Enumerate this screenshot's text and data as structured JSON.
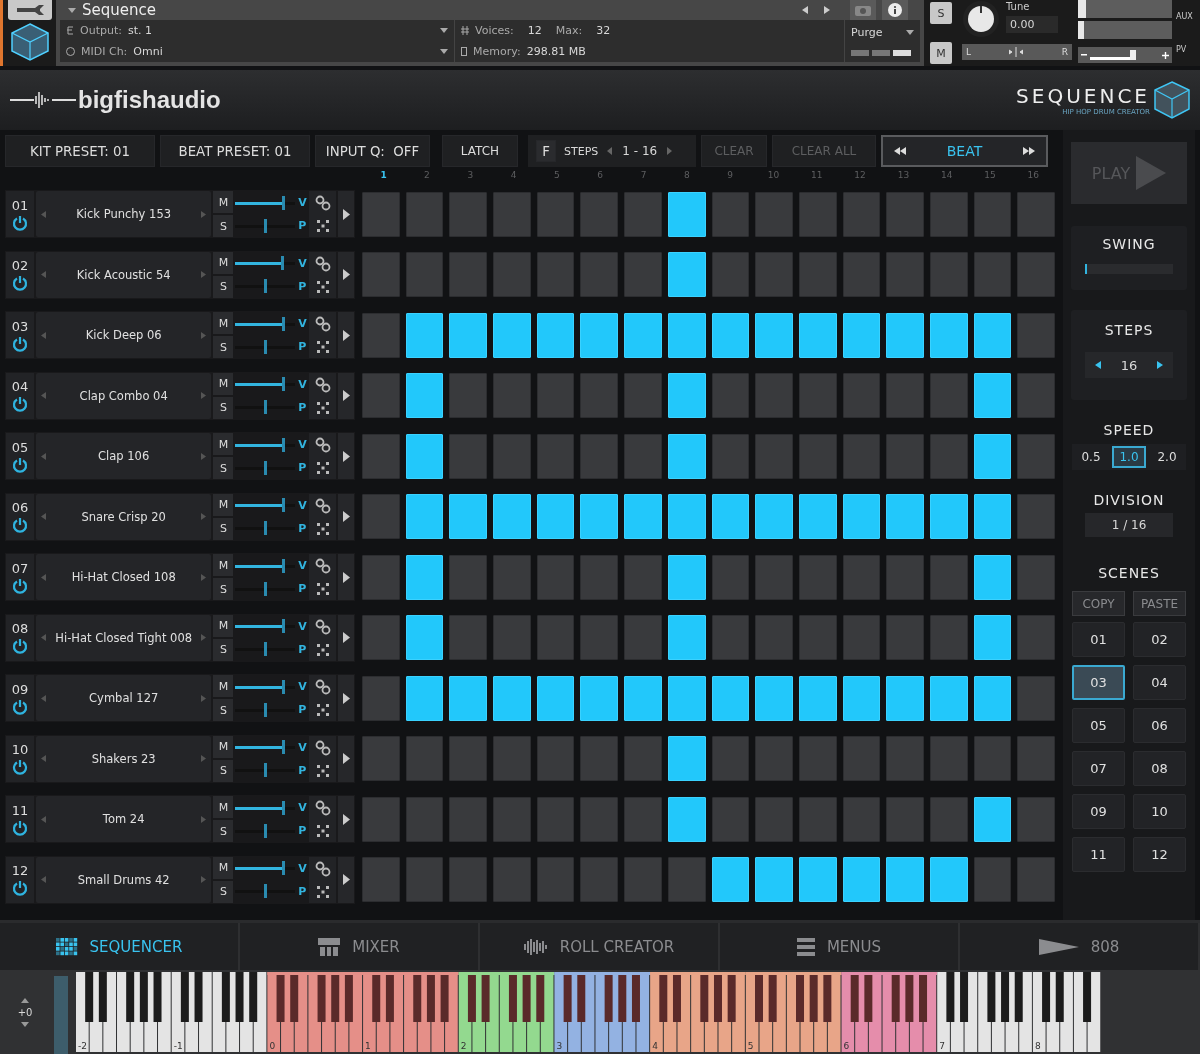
{
  "host": {
    "title": "Sequence",
    "output_label": "Output:",
    "output": "st. 1",
    "midi_label": "MIDI Ch:",
    "midi": "Omni",
    "voices_label": "Voices:",
    "voices": "12",
    "max_label": "Max:",
    "max": "32",
    "memory_label": "Memory:",
    "memory": "298.81 MB",
    "purge": "Purge",
    "solo": "S",
    "mute": "M",
    "tune_label": "Tune",
    "tune": "0.00",
    "pan_left": "L",
    "pan_right": "R",
    "aux": "AUX",
    "pv": "PV",
    "meters": [
      {
        "level": 0.08
      },
      {
        "level": 0.06
      }
    ],
    "pan": {
      "level": 0.5
    },
    "volume": {
      "level": 0.62
    }
  },
  "brand": {
    "name": "bigfishaudio",
    "product": "SEQUENCE",
    "tagline": "HIP HOP DRUM CREATOR"
  },
  "toolbar": {
    "kit_preset": "KIT PRESET: 01",
    "beat_preset": "BEAT PRESET: 01",
    "input_q": "INPUT Q:  OFF",
    "latch": "LATCH",
    "f": "F",
    "steps_label": "STEPS",
    "steps_range": "1 - 16",
    "clear": {
      "label": "CLEAR",
      "disabled": true
    },
    "clear_all": {
      "label": "CLEAR ALL",
      "disabled": true
    },
    "mode": "BEAT"
  },
  "step_numbers": [
    {
      "label": "1",
      "highlighted": true
    },
    {
      "label": "2",
      "highlighted": false
    },
    {
      "label": "3",
      "highlighted": false
    },
    {
      "label": "4",
      "highlighted": false
    },
    {
      "label": "5",
      "highlighted": false
    },
    {
      "label": "6",
      "highlighted": false
    },
    {
      "label": "7",
      "highlighted": false
    },
    {
      "label": "8",
      "highlighted": false
    },
    {
      "label": "9",
      "highlighted": false
    },
    {
      "label": "10",
      "highlighted": false
    },
    {
      "label": "11",
      "highlighted": false
    },
    {
      "label": "12",
      "highlighted": false
    },
    {
      "label": "13",
      "highlighted": false
    },
    {
      "label": "14",
      "highlighted": false
    },
    {
      "label": "15",
      "highlighted": false
    },
    {
      "label": "16",
      "highlighted": false
    }
  ],
  "tracks": [
    {
      "number": "01",
      "power_on": true,
      "name": "Kick Punchy 153",
      "mute_label": "M",
      "solo_label": "S",
      "volume_label": "V",
      "pan_label": "P",
      "volume": {
        "level": 0.8
      },
      "pan": {
        "level": 0.5
      },
      "steps": [
        false,
        false,
        false,
        false,
        false,
        false,
        false,
        true,
        false,
        false,
        false,
        false,
        false,
        false,
        false,
        false
      ]
    },
    {
      "number": "02",
      "power_on": true,
      "name": "Kick Acoustic 54",
      "mute_label": "M",
      "solo_label": "S",
      "volume_label": "V",
      "pan_label": "P",
      "volume": {
        "level": 0.78
      },
      "pan": {
        "level": 0.5
      },
      "steps": [
        false,
        false,
        false,
        false,
        false,
        false,
        false,
        true,
        false,
        false,
        false,
        false,
        false,
        false,
        false,
        false
      ]
    },
    {
      "number": "03",
      "power_on": true,
      "name": "Kick Deep 06",
      "mute_label": "M",
      "solo_label": "S",
      "volume_label": "V",
      "pan_label": "P",
      "volume": {
        "level": 0.8
      },
      "pan": {
        "level": 0.5
      },
      "steps": [
        false,
        true,
        true,
        true,
        true,
        true,
        true,
        true,
        true,
        true,
        true,
        true,
        true,
        true,
        true,
        false
      ]
    },
    {
      "number": "04",
      "power_on": true,
      "name": "Clap Combo 04",
      "mute_label": "M",
      "solo_label": "S",
      "volume_label": "V",
      "pan_label": "P",
      "volume": {
        "level": 0.8
      },
      "pan": {
        "level": 0.5
      },
      "steps": [
        false,
        true,
        false,
        false,
        false,
        false,
        false,
        true,
        false,
        false,
        false,
        false,
        false,
        false,
        true,
        false
      ]
    },
    {
      "number": "05",
      "power_on": true,
      "name": "Clap 106",
      "mute_label": "M",
      "solo_label": "S",
      "volume_label": "V",
      "pan_label": "P",
      "volume": {
        "level": 0.8
      },
      "pan": {
        "level": 0.5
      },
      "steps": [
        false,
        true,
        false,
        false,
        false,
        false,
        false,
        true,
        false,
        false,
        false,
        false,
        false,
        false,
        true,
        false
      ]
    },
    {
      "number": "06",
      "power_on": true,
      "name": "Snare Crisp 20",
      "mute_label": "M",
      "solo_label": "S",
      "volume_label": "V",
      "pan_label": "P",
      "volume": {
        "level": 0.8
      },
      "pan": {
        "level": 0.5
      },
      "steps": [
        false,
        true,
        true,
        true,
        true,
        true,
        true,
        true,
        true,
        true,
        true,
        true,
        true,
        true,
        true,
        false
      ]
    },
    {
      "number": "07",
      "power_on": true,
      "name": "Hi-Hat Closed 108",
      "mute_label": "M",
      "solo_label": "S",
      "volume_label": "V",
      "pan_label": "P",
      "volume": {
        "level": 0.8
      },
      "pan": {
        "level": 0.5
      },
      "steps": [
        false,
        true,
        false,
        false,
        false,
        false,
        false,
        true,
        false,
        false,
        false,
        false,
        false,
        false,
        true,
        false
      ]
    },
    {
      "number": "08",
      "power_on": true,
      "name": "Hi-Hat Closed Tight 008",
      "mute_label": "M",
      "solo_label": "S",
      "volume_label": "V",
      "pan_label": "P",
      "volume": {
        "level": 0.8
      },
      "pan": {
        "level": 0.5
      },
      "steps": [
        false,
        true,
        false,
        false,
        false,
        false,
        false,
        true,
        false,
        false,
        false,
        false,
        false,
        false,
        true,
        false
      ]
    },
    {
      "number": "09",
      "power_on": true,
      "name": "Cymbal 127",
      "mute_label": "M",
      "solo_label": "S",
      "volume_label": "V",
      "pan_label": "P",
      "volume": {
        "level": 0.8
      },
      "pan": {
        "level": 0.5
      },
      "steps": [
        false,
        true,
        true,
        true,
        true,
        true,
        true,
        true,
        true,
        true,
        true,
        true,
        true,
        true,
        true,
        false
      ]
    },
    {
      "number": "10",
      "power_on": true,
      "name": "Shakers 23",
      "mute_label": "M",
      "solo_label": "S",
      "volume_label": "V",
      "pan_label": "P",
      "volume": {
        "level": 0.8
      },
      "pan": {
        "level": 0.5
      },
      "steps": [
        false,
        false,
        false,
        false,
        false,
        false,
        false,
        true,
        false,
        false,
        false,
        false,
        false,
        false,
        false,
        false
      ]
    },
    {
      "number": "11",
      "power_on": true,
      "name": "Tom 24",
      "mute_label": "M",
      "solo_label": "S",
      "volume_label": "V",
      "pan_label": "P",
      "volume": {
        "level": 0.8
      },
      "pan": {
        "level": 0.5
      },
      "steps": [
        false,
        false,
        false,
        false,
        false,
        false,
        false,
        true,
        false,
        false,
        false,
        false,
        false,
        false,
        true,
        false
      ]
    },
    {
      "number": "12",
      "power_on": true,
      "name": "Small Drums 42",
      "mute_label": "M",
      "solo_label": "S",
      "volume_label": "V",
      "pan_label": "P",
      "volume": {
        "level": 0.8
      },
      "pan": {
        "level": 0.5
      },
      "steps": [
        false,
        false,
        false,
        false,
        false,
        false,
        false,
        false,
        true,
        true,
        true,
        true,
        true,
        true,
        false,
        false
      ]
    }
  ],
  "side": {
    "play": "PLAY",
    "swing": {
      "label": "SWING",
      "level": 0.02
    },
    "steps": {
      "label": "STEPS",
      "value": "16"
    },
    "speed": {
      "label": "SPEED",
      "options": [
        {
          "label": "0.5",
          "selected": false
        },
        {
          "label": "1.0",
          "selected": true
        },
        {
          "label": "2.0",
          "selected": false
        }
      ]
    },
    "division": {
      "label": "DIVISION",
      "value": "1 / 16"
    },
    "scenes": {
      "label": "SCENES",
      "copy": "COPY",
      "paste": "PASTE",
      "items": [
        {
          "label": "01",
          "selected": false
        },
        {
          "label": "02",
          "selected": false
        },
        {
          "label": "03",
          "selected": true
        },
        {
          "label": "04",
          "selected": false
        },
        {
          "label": "05",
          "selected": false
        },
        {
          "label": "06",
          "selected": false
        },
        {
          "label": "07",
          "selected": false
        },
        {
          "label": "08",
          "selected": false
        },
        {
          "label": "09",
          "selected": false
        },
        {
          "label": "10",
          "selected": false
        },
        {
          "label": "11",
          "selected": false
        },
        {
          "label": "12",
          "selected": false
        }
      ]
    }
  },
  "tabs": [
    {
      "label": "SEQUENCER",
      "selected": true,
      "kind": "grid"
    },
    {
      "label": "MIXER",
      "selected": false,
      "kind": "mixer"
    },
    {
      "label": "ROLL CREATOR",
      "selected": false,
      "kind": "roll"
    },
    {
      "label": "MENUS",
      "selected": false,
      "kind": "menus"
    },
    {
      "label": "808",
      "selected": false,
      "kind": "horn"
    }
  ],
  "keyboard": {
    "transpose": "+0",
    "octaves": [
      {
        "label": "-2"
      },
      {
        "label": "-1"
      },
      {
        "label": "0",
        "color": "#e58f88"
      },
      {
        "label": "1",
        "color": "#e58f88"
      },
      {
        "label": "2",
        "color": "#93d98f"
      },
      {
        "label": "3",
        "color": "#93b2e2"
      },
      {
        "label": "4",
        "color": "#e8a588"
      },
      {
        "label": "5",
        "color": "#e8a588"
      },
      {
        "label": "6",
        "color": "#e58dab"
      },
      {
        "label": "7"
      },
      {
        "label": "8"
      }
    ]
  }
}
